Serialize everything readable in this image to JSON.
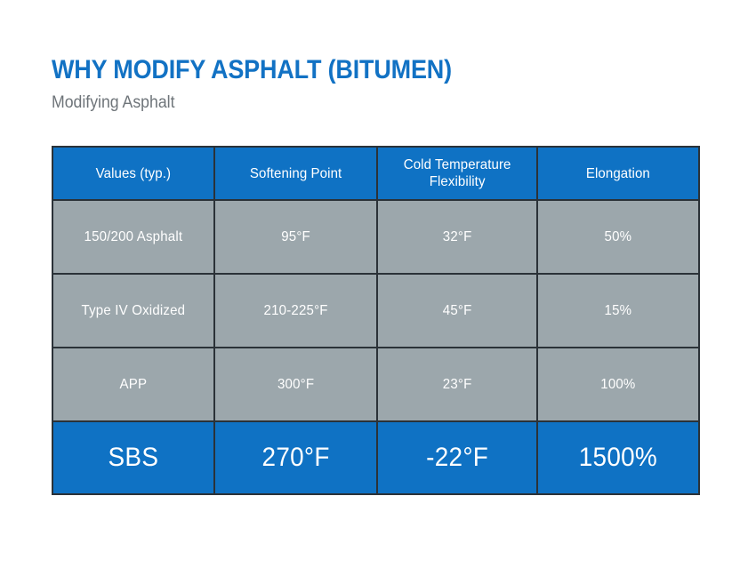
{
  "header": {
    "title": "WHY MODIFY ASPHALT (BITUMEN)",
    "subtitle": "Modifying Asphalt"
  },
  "colors": {
    "brand_blue": "#0f72c4",
    "title_blue": "#1272c4",
    "row_gray": "#9ca7ac",
    "border_dark": "#2b3238",
    "subtitle_gray": "#6e7479",
    "text_white": "#ffffff",
    "background": "#ffffff"
  },
  "table": {
    "columns": [
      {
        "label": "Values (typ.)",
        "lines": [
          "Values (typ.)"
        ]
      },
      {
        "label": "Softening Point",
        "lines": [
          "Softening Point"
        ]
      },
      {
        "label": "Cold Temperature Flexibility",
        "lines": [
          "Cold Temperature",
          "Flexibility"
        ]
      },
      {
        "label": "Elongation",
        "lines": [
          "Elongation"
        ]
      }
    ],
    "rows": [
      {
        "name": "150/200 Asphalt",
        "highlight": false,
        "cells": [
          "150/200 Asphalt",
          "95°F",
          "32°F",
          "50%"
        ]
      },
      {
        "name": "Type IV Oxidized",
        "highlight": false,
        "cells": [
          "Type IV Oxidized",
          "210-225°F",
          "45°F",
          "15%"
        ]
      },
      {
        "name": "APP",
        "highlight": false,
        "cells": [
          "APP",
          "300°F",
          "23°F",
          "100%"
        ]
      },
      {
        "name": "SBS",
        "highlight": true,
        "cells": [
          "SBS",
          "270°F",
          "-22°F",
          "1500%"
        ]
      }
    ]
  },
  "chart_data": {
    "type": "table",
    "title": "WHY MODIFY ASPHALT (BITUMEN)",
    "subtitle": "Modifying Asphalt",
    "columns": [
      "Values (typ.)",
      "Softening Point",
      "Cold Temperature Flexibility",
      "Elongation"
    ],
    "rows": [
      [
        "150/200 Asphalt",
        "95°F",
        "32°F",
        "50%"
      ],
      [
        "Type IV Oxidized",
        "210-225°F",
        "45°F",
        "15%"
      ],
      [
        "APP",
        "300°F",
        "23°F",
        "100%"
      ],
      [
        "SBS",
        "270°F",
        "-22°F",
        "1500%"
      ]
    ],
    "highlighted_row_index": 3,
    "series": [
      {
        "name": "Softening Point (°F)",
        "categories": [
          "150/200 Asphalt",
          "Type IV Oxidized",
          "APP",
          "SBS"
        ],
        "values": [
          95,
          217.5,
          300,
          270
        ]
      },
      {
        "name": "Cold Temperature Flexibility (°F)",
        "categories": [
          "150/200 Asphalt",
          "Type IV Oxidized",
          "APP",
          "SBS"
        ],
        "values": [
          32,
          45,
          23,
          -22
        ]
      },
      {
        "name": "Elongation (%)",
        "categories": [
          "150/200 Asphalt",
          "Type IV Oxidized",
          "APP",
          "SBS"
        ],
        "values": [
          50,
          15,
          100,
          1500
        ]
      }
    ]
  }
}
